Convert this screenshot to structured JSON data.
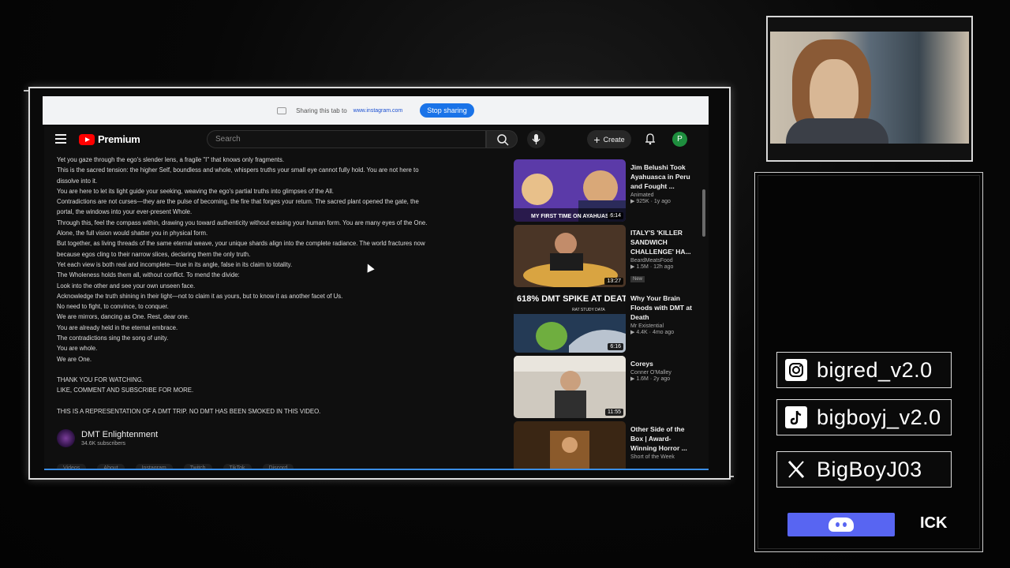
{
  "share_bar": {
    "message": "Sharing this tab to",
    "site": "www.instagram.com",
    "stop_label": "Stop sharing"
  },
  "youtube": {
    "brand": "Premium",
    "search_placeholder": "Search",
    "create_label": "Create",
    "avatar_letter": "P",
    "description": [
      "Yet you gaze through the ego's slender lens, a fragile \"I\" that knows only fragments.",
      "This is the sacred tension: the higher Self, boundless and whole, whispers truths your small eye cannot fully hold. You are not here to",
      "dissolve into it.",
      "You are here to let its light guide your seeking, weaving the ego's partial truths into glimpses of the All.",
      "Contradictions are not curses—they are the pulse of becoming, the fire that forges your return. The sacred plant opened  the gate, the",
      "portal, the windows into your ever-present Whole.",
      "Through this, feel the compass within, drawing you toward authenticity without erasing your human form. You are many eyes of the One.",
      "Alone, the full vision would shatter you in physical form.",
      "But together, as living threads of the same eternal weave, your unique shards align into the complete radiance.  The world fractures now",
      "because egos cling to their narrow slices, declaring them the only truth.",
      "Yet each view is both real and incomplete—true in its angle, false in its claim to totality.",
      "The Wholeness holds them all, without conflict. To mend the divide:",
      "Look into the other and see your own unseen face.",
      "Acknowledge the truth shining in their light—not to claim it as yours, but to know it as another facet of Us.",
      "No need to fight, to convince, to conquer.",
      "We are mirrors, dancing as One. Rest, dear one.",
      "You are already held in the eternal embrace.",
      "The contradictions sing the song of unity.",
      "You are whole.",
      "We are One."
    ],
    "closing": [
      "THANK YOU FOR WATCHING.",
      "LIKE, COMMENT AND SUBSCRIBE FOR MORE."
    ],
    "disclaimer": "THIS IS A REPRESENTATION OF A DMT TRIP. NO DMT HAS BEEN SMOKED IN THIS VIDEO.",
    "channel": {
      "name": "DMT Enlightenment",
      "subscribers": "34.6K subscribers"
    },
    "channel_links": [
      "Videos",
      "About",
      "Instagram",
      "Twitch",
      "TikTok",
      "Discord"
    ],
    "recommendations": [
      {
        "title": "Jim Belushi Took Ayahuasca in Peru and Fought ...",
        "channel": "Animated",
        "meta": "▶ 925K · 1y ago",
        "duration": "6:14",
        "thumb_text": "MY FIRST TIME ON AYAHUASCA",
        "color": "#6a3fb0"
      },
      {
        "title": "ITALY'S 'KILLER SANDWICH CHALLENGE' HA...",
        "channel": "BeardMeatsFood",
        "meta": "▶ 1.5M · 12h ago",
        "badge": "New",
        "duration": "13:27",
        "color": "#6b4a2a"
      },
      {
        "title": "Why Your Brain Floods with DMT at Death",
        "channel": "Mr Existential",
        "meta": "▶ 4.4K · 4mo ago",
        "duration": "6:16",
        "thumb_text": "618% DMT SPIKE AT DEATH",
        "thumb_sub": "RAT STUDY DATA",
        "color": "#2e4a6b"
      },
      {
        "title": "Coreys",
        "channel": "Conner O'Malley",
        "meta": "▶ 1.6M · 2y ago",
        "duration": "11:55",
        "color": "#c8c2b8"
      },
      {
        "title": "Other Side of the Box | Award-Winning Horror ...",
        "channel": "Short of the Week",
        "meta": "",
        "duration": "",
        "color": "#5a3a1e"
      }
    ]
  },
  "overlay": {
    "socials": [
      {
        "icon": "instagram-icon",
        "handle": "bigred_v2.0"
      },
      {
        "icon": "tiktok-icon",
        "handle": "bigboyj_v2.0"
      },
      {
        "icon": "x-icon",
        "handle": "BigBoyJ03"
      }
    ],
    "discord_tag": "ICK"
  }
}
